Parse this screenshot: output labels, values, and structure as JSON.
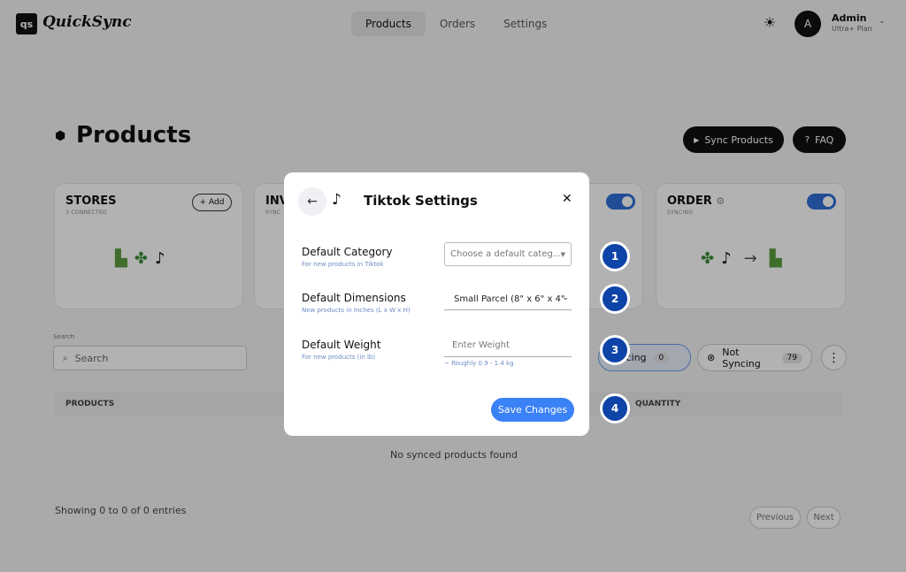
{
  "header": {
    "logo_mark": "qs",
    "logo_text": "QuickSync",
    "nav": [
      "Products",
      "Orders",
      "Settings"
    ],
    "user_initial": "A",
    "user_name": "Admin",
    "user_plan": "Ultra+ Plan"
  },
  "page": {
    "title": "Products",
    "sync_button": "Sync Products",
    "faq_button": "FAQ"
  },
  "cards": {
    "stores": {
      "title": "STORES",
      "sub": "3 CONNECTED",
      "add": "Add"
    },
    "inventory": {
      "title": "INV",
      "sub": "SYNC"
    },
    "order": {
      "title": "ORDER",
      "sub": "SYNCING"
    }
  },
  "filters": {
    "search_label": "Search",
    "search_placeholder": "Search",
    "syncing_label": "Syncing",
    "syncing_count": "0",
    "not_syncing_label": "Not Syncing",
    "not_syncing_count": "79"
  },
  "table": {
    "col_products": "PRODUCTS",
    "col_quantity": "QUANTITY",
    "empty": "No synced products found",
    "entries": "Showing 0 to 0 of 0 entries",
    "prev": "Previous",
    "next": "Next"
  },
  "modal": {
    "title": "Tiktok Settings",
    "category_label": "Default Category",
    "category_hint": "For new products in Tiktok",
    "category_placeholder": "Choose a default categ...",
    "dimensions_label": "Default Dimensions",
    "dimensions_hint": "New products in Inches (L x W x H)",
    "dimensions_value": "Small Parcel (8\" x 6\" x 4\"",
    "weight_label": "Default Weight",
    "weight_hint": "For new products (in lb)",
    "weight_placeholder": "Enter Weight",
    "weight_sub_hint": "~ Roughly 0.9 - 1.4 kg",
    "save": "Save Changes"
  },
  "markers": [
    "1",
    "2",
    "3",
    "4"
  ],
  "colors": {
    "accent": "#3b82f6",
    "marker": "#0e44a8",
    "toggle": "#2f6fd6"
  },
  "icons": {
    "theme": "sun-icon",
    "back": "arrow-left-icon",
    "close": "close-icon",
    "tiktok": "tiktok-icon"
  }
}
